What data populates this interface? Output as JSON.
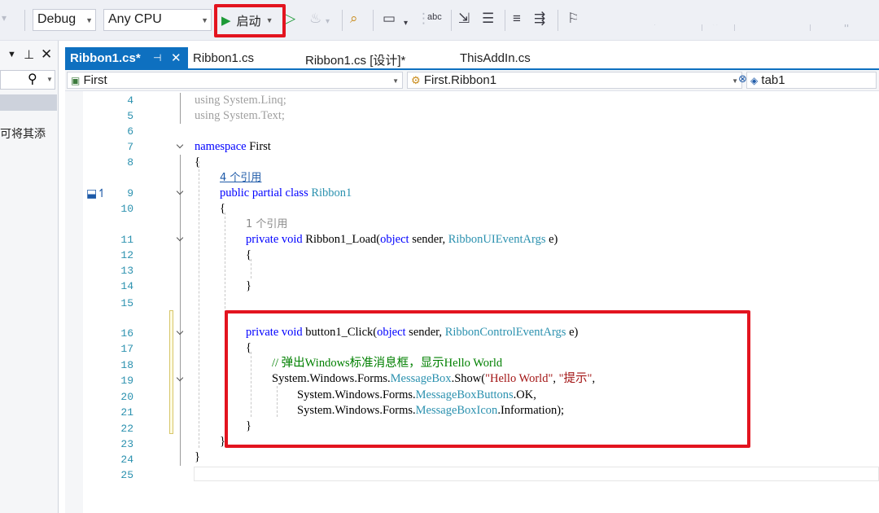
{
  "toolbar": {
    "config": "Debug",
    "platform": "Any CPU",
    "start_label": "启动"
  },
  "solution_panel": {
    "partial_text": "可将其添"
  },
  "tabs": [
    {
      "label": "Ribbon1.cs*",
      "active": true
    },
    {
      "label": "Ribbon1.cs"
    },
    {
      "label": "Ribbon1.cs [设计]*"
    },
    {
      "label": "ThisAddIn.cs"
    }
  ],
  "nav": {
    "project": "First",
    "class": "First.Ribbon1",
    "member": "tab1"
  },
  "code": {
    "ln4": "4",
    "ln5": "5",
    "ln6": "6",
    "ln7": "7",
    "ln8": "8",
    "ln9": "9",
    "ln10": "10",
    "ln11": "11",
    "ln12": "12",
    "ln13": "13",
    "ln14": "14",
    "ln15": "15",
    "ln16": "16",
    "ln17": "17",
    "ln18": "18",
    "ln19": "19",
    "ln20": "20",
    "ln21": "21",
    "ln22": "22",
    "ln23": "23",
    "ln24": "24",
    "ln25": "25",
    "l4_using": "using",
    "l4_ns": "System.Linq;",
    "l5_using": "using",
    "l5_ns": "System.Text;",
    "l7_kw": "namespace",
    "l7_name": "First",
    "open_brace": "{",
    "close_brace": "}",
    "lens_refs_4": "4 个引用",
    "l9_kw": "public partial class",
    "l9_name": "Ribbon1",
    "lens_refs_1": "1 个引用",
    "l11_kw": "private void",
    "l11_method": "Ribbon1_Load(",
    "l11_obj": "object",
    "l11_sender": "sender,",
    "l11_type": "RibbonUIEventArgs",
    "l11_e": "e)",
    "l16_kw": "private void",
    "l16_method": "button1_Click(",
    "l16_obj": "object",
    "l16_sender": "sender,",
    "l16_type": "RibbonControlEventArgs",
    "l16_e": "e)",
    "l18_comment": "// 弹出Windows标准消息框，显示Hello World",
    "l19_ns": "System.Windows.Forms.",
    "l19_type": "MessageBox",
    "l19_show": ".Show(",
    "l19_str1": "\"Hello World\"",
    "l19_comma": ", ",
    "l19_str2": "\"提示\"",
    "l19_end": ",",
    "l20_ns": "System.Windows.Forms.",
    "l20_type": "MessageBoxButtons",
    "l20_end": ".OK,",
    "l21_ns": "System.Windows.Forms.",
    "l21_type": "MessageBoxIcon",
    "l21_end": ".Information);"
  }
}
